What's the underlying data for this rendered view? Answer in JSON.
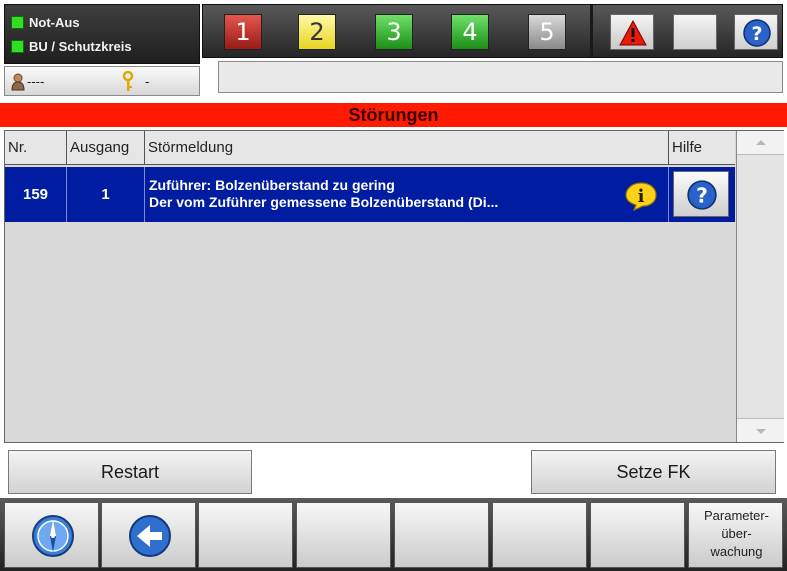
{
  "header": {
    "status_items": [
      "Not-Aus",
      "BU / Schutzkreis"
    ],
    "user_name": "----",
    "access_level": "-",
    "toolbar_numbers": [
      "1",
      "2",
      "3",
      "4",
      "5"
    ]
  },
  "title": "Störungen",
  "table": {
    "columns": [
      "Nr.",
      "Ausgang",
      "Störmeldung",
      "Hilfe"
    ],
    "rows": [
      {
        "nr": "159",
        "ausgang": "1",
        "meldung_line1": "Zuführer: Bolzenüberstand zu gering",
        "meldung_line2": "Der vom Zuführer gemessene Bolzenüberstand (Di..."
      }
    ]
  },
  "actions": {
    "restart": "Restart",
    "setze_fk": "Setze FK"
  },
  "bottom_nav": {
    "parameter_label_1": "Parameter-",
    "parameter_label_2": "über-",
    "parameter_label_3": "wachung"
  },
  "colors": {
    "title_bar": "#ff1a00",
    "selected_row": "#001ca0",
    "status_led": "#33dd22"
  }
}
